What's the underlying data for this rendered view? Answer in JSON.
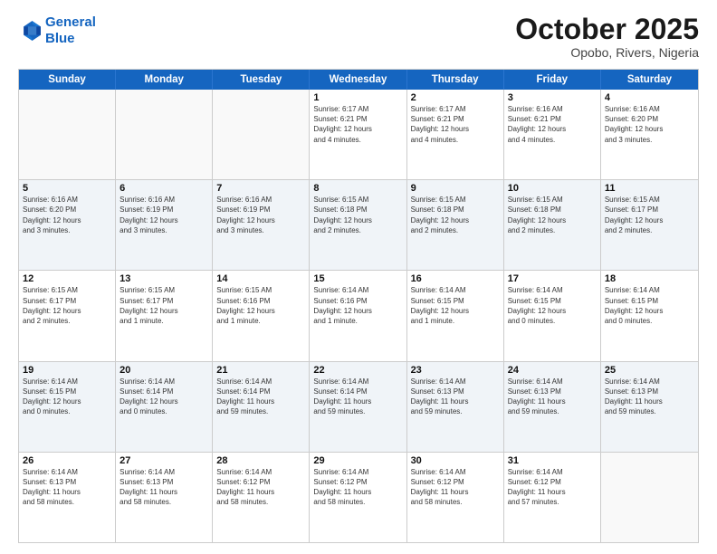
{
  "header": {
    "logo_line1": "General",
    "logo_line2": "Blue",
    "month": "October 2025",
    "location": "Opobo, Rivers, Nigeria"
  },
  "days_of_week": [
    "Sunday",
    "Monday",
    "Tuesday",
    "Wednesday",
    "Thursday",
    "Friday",
    "Saturday"
  ],
  "weeks": [
    [
      {
        "day": "",
        "text": ""
      },
      {
        "day": "",
        "text": ""
      },
      {
        "day": "",
        "text": ""
      },
      {
        "day": "1",
        "text": "Sunrise: 6:17 AM\nSunset: 6:21 PM\nDaylight: 12 hours\nand 4 minutes."
      },
      {
        "day": "2",
        "text": "Sunrise: 6:17 AM\nSunset: 6:21 PM\nDaylight: 12 hours\nand 4 minutes."
      },
      {
        "day": "3",
        "text": "Sunrise: 6:16 AM\nSunset: 6:21 PM\nDaylight: 12 hours\nand 4 minutes."
      },
      {
        "day": "4",
        "text": "Sunrise: 6:16 AM\nSunset: 6:20 PM\nDaylight: 12 hours\nand 3 minutes."
      }
    ],
    [
      {
        "day": "5",
        "text": "Sunrise: 6:16 AM\nSunset: 6:20 PM\nDaylight: 12 hours\nand 3 minutes."
      },
      {
        "day": "6",
        "text": "Sunrise: 6:16 AM\nSunset: 6:19 PM\nDaylight: 12 hours\nand 3 minutes."
      },
      {
        "day": "7",
        "text": "Sunrise: 6:16 AM\nSunset: 6:19 PM\nDaylight: 12 hours\nand 3 minutes."
      },
      {
        "day": "8",
        "text": "Sunrise: 6:15 AM\nSunset: 6:18 PM\nDaylight: 12 hours\nand 2 minutes."
      },
      {
        "day": "9",
        "text": "Sunrise: 6:15 AM\nSunset: 6:18 PM\nDaylight: 12 hours\nand 2 minutes."
      },
      {
        "day": "10",
        "text": "Sunrise: 6:15 AM\nSunset: 6:18 PM\nDaylight: 12 hours\nand 2 minutes."
      },
      {
        "day": "11",
        "text": "Sunrise: 6:15 AM\nSunset: 6:17 PM\nDaylight: 12 hours\nand 2 minutes."
      }
    ],
    [
      {
        "day": "12",
        "text": "Sunrise: 6:15 AM\nSunset: 6:17 PM\nDaylight: 12 hours\nand 2 minutes."
      },
      {
        "day": "13",
        "text": "Sunrise: 6:15 AM\nSunset: 6:17 PM\nDaylight: 12 hours\nand 1 minute."
      },
      {
        "day": "14",
        "text": "Sunrise: 6:15 AM\nSunset: 6:16 PM\nDaylight: 12 hours\nand 1 minute."
      },
      {
        "day": "15",
        "text": "Sunrise: 6:14 AM\nSunset: 6:16 PM\nDaylight: 12 hours\nand 1 minute."
      },
      {
        "day": "16",
        "text": "Sunrise: 6:14 AM\nSunset: 6:15 PM\nDaylight: 12 hours\nand 1 minute."
      },
      {
        "day": "17",
        "text": "Sunrise: 6:14 AM\nSunset: 6:15 PM\nDaylight: 12 hours\nand 0 minutes."
      },
      {
        "day": "18",
        "text": "Sunrise: 6:14 AM\nSunset: 6:15 PM\nDaylight: 12 hours\nand 0 minutes."
      }
    ],
    [
      {
        "day": "19",
        "text": "Sunrise: 6:14 AM\nSunset: 6:15 PM\nDaylight: 12 hours\nand 0 minutes."
      },
      {
        "day": "20",
        "text": "Sunrise: 6:14 AM\nSunset: 6:14 PM\nDaylight: 12 hours\nand 0 minutes."
      },
      {
        "day": "21",
        "text": "Sunrise: 6:14 AM\nSunset: 6:14 PM\nDaylight: 11 hours\nand 59 minutes."
      },
      {
        "day": "22",
        "text": "Sunrise: 6:14 AM\nSunset: 6:14 PM\nDaylight: 11 hours\nand 59 minutes."
      },
      {
        "day": "23",
        "text": "Sunrise: 6:14 AM\nSunset: 6:13 PM\nDaylight: 11 hours\nand 59 minutes."
      },
      {
        "day": "24",
        "text": "Sunrise: 6:14 AM\nSunset: 6:13 PM\nDaylight: 11 hours\nand 59 minutes."
      },
      {
        "day": "25",
        "text": "Sunrise: 6:14 AM\nSunset: 6:13 PM\nDaylight: 11 hours\nand 59 minutes."
      }
    ],
    [
      {
        "day": "26",
        "text": "Sunrise: 6:14 AM\nSunset: 6:13 PM\nDaylight: 11 hours\nand 58 minutes."
      },
      {
        "day": "27",
        "text": "Sunrise: 6:14 AM\nSunset: 6:13 PM\nDaylight: 11 hours\nand 58 minutes."
      },
      {
        "day": "28",
        "text": "Sunrise: 6:14 AM\nSunset: 6:12 PM\nDaylight: 11 hours\nand 58 minutes."
      },
      {
        "day": "29",
        "text": "Sunrise: 6:14 AM\nSunset: 6:12 PM\nDaylight: 11 hours\nand 58 minutes."
      },
      {
        "day": "30",
        "text": "Sunrise: 6:14 AM\nSunset: 6:12 PM\nDaylight: 11 hours\nand 58 minutes."
      },
      {
        "day": "31",
        "text": "Sunrise: 6:14 AM\nSunset: 6:12 PM\nDaylight: 11 hours\nand 57 minutes."
      },
      {
        "day": "",
        "text": ""
      }
    ]
  ]
}
